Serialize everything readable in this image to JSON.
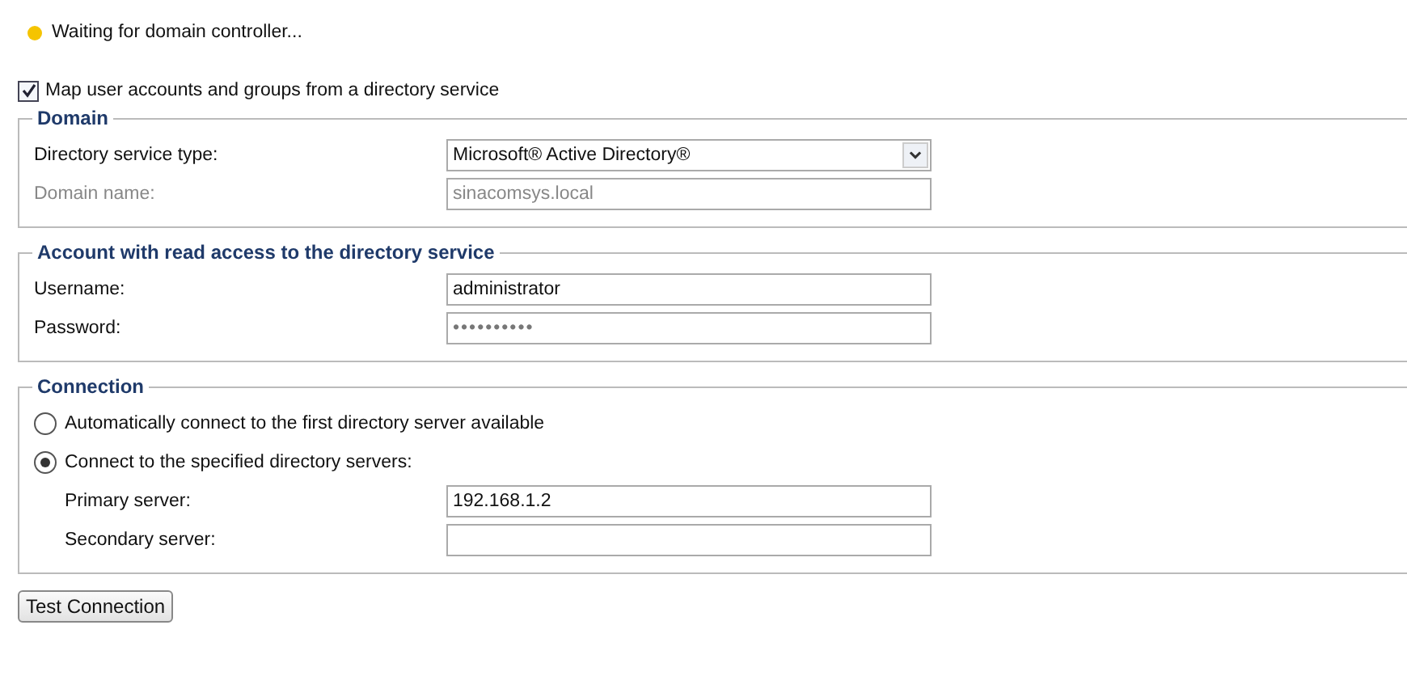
{
  "status": {
    "text": "Waiting for domain controller..."
  },
  "map_directory": {
    "label": "Map user accounts and groups from a directory service",
    "checked": true
  },
  "domain": {
    "legend": "Domain",
    "fields": [
      {
        "kind": "select",
        "label": "Directory service type:",
        "value": "Microsoft® Active Directory®",
        "disabled": false
      },
      {
        "kind": "text",
        "label": "Domain name:",
        "value": "sinacomsys.local",
        "disabled": true
      }
    ]
  },
  "account": {
    "legend": "Account with read access to the directory service",
    "fields": [
      {
        "kind": "text",
        "label": "Username:",
        "value": "administrator",
        "disabled": false
      },
      {
        "kind": "password",
        "label": "Password:",
        "value": "••••••••••",
        "disabled": false
      }
    ]
  },
  "connection": {
    "legend": "Connection",
    "options": [
      {
        "label": "Automatically connect to the first directory server available",
        "selected": false
      },
      {
        "label": "Connect to the specified directory servers:",
        "selected": true
      }
    ],
    "servers": [
      {
        "kind": "text",
        "label": "Primary server:",
        "value": "192.168.1.2",
        "disabled": false
      },
      {
        "kind": "text",
        "label": "Secondary server:",
        "disabled": false
      }
    ]
  },
  "button": {
    "label": "Test Connection"
  }
}
